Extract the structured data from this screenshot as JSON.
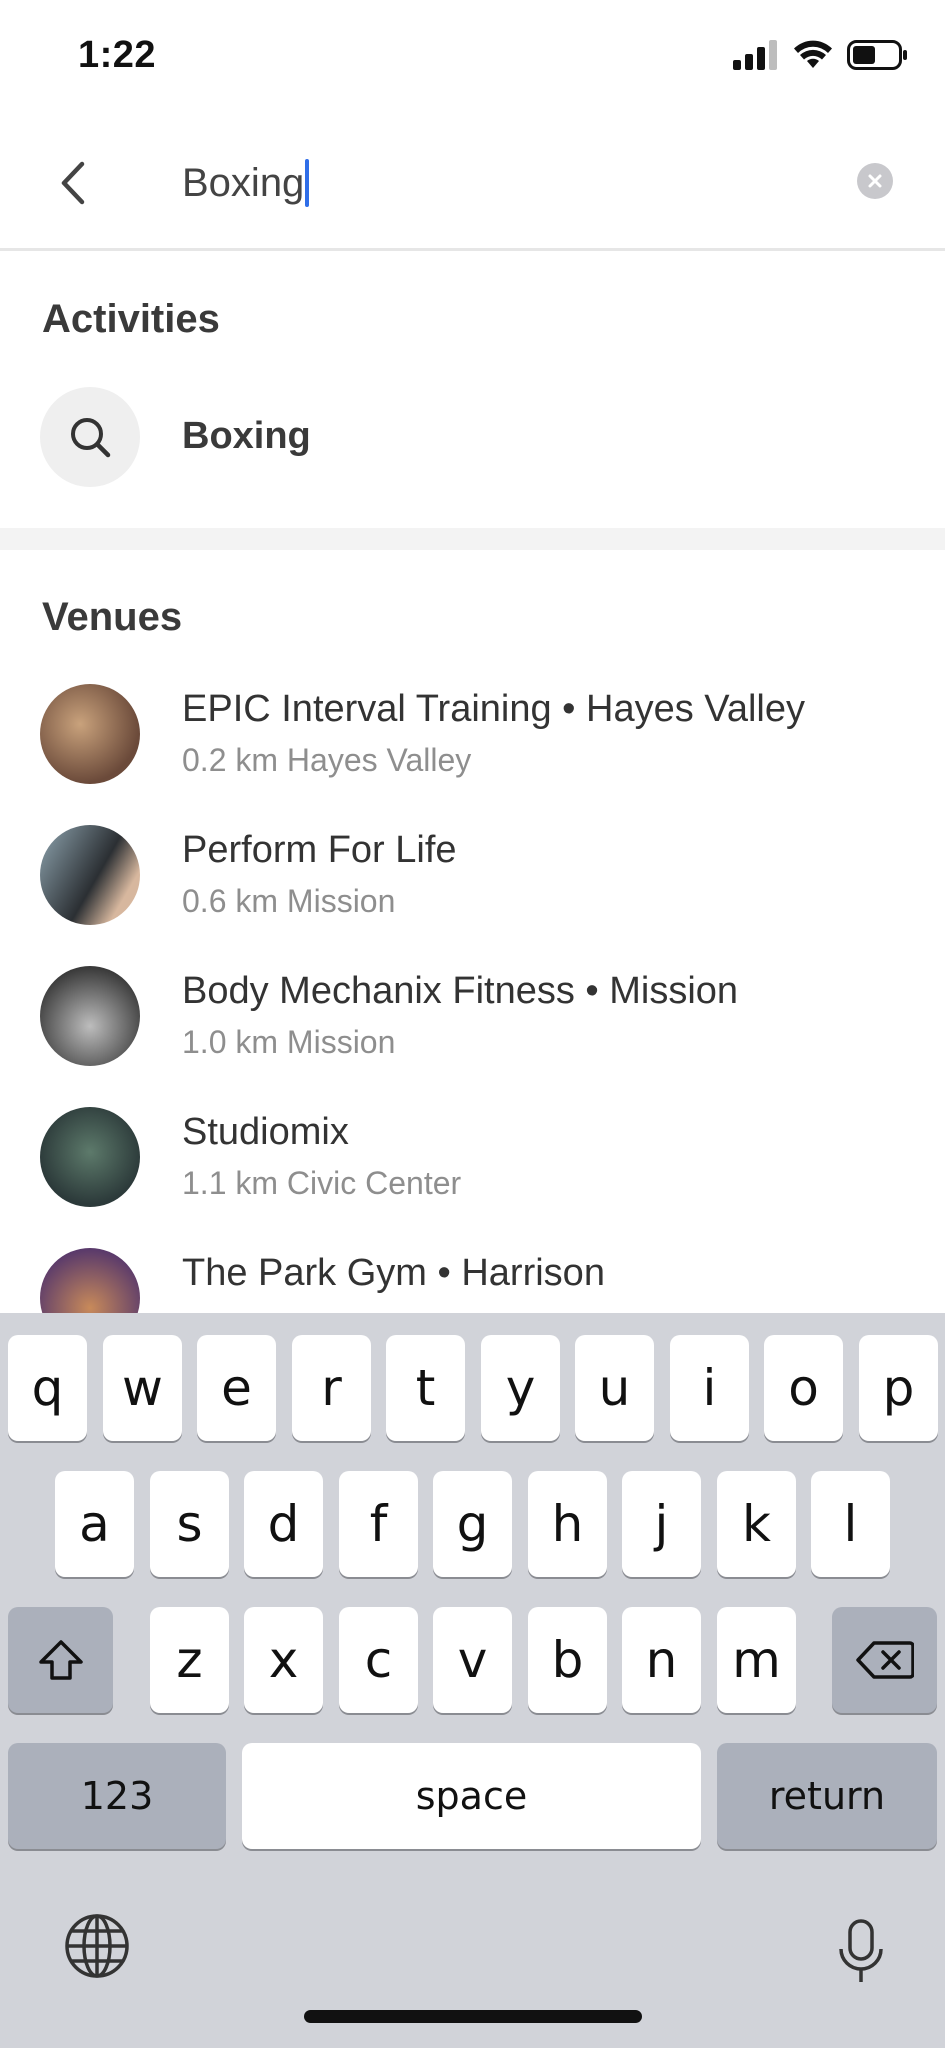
{
  "status_bar": {
    "time": "1:22"
  },
  "search": {
    "query": "Boxing"
  },
  "activities": {
    "title": "Activities",
    "items": [
      {
        "label": "Boxing",
        "icon": "search-icon"
      }
    ]
  },
  "venues": {
    "title": "Venues",
    "items": [
      {
        "name": "EPIC Interval Training • Hayes Valley",
        "sub": "0.2 km Hayes Valley",
        "avatar_colors": [
          "#6b4a3a",
          "#c9a27c"
        ]
      },
      {
        "name": "Perform For Life",
        "sub": "0.6 km Mission",
        "avatar_colors": [
          "#2b2f33",
          "#8fa5b0"
        ]
      },
      {
        "name": "Body Mechanix Fitness  • Mission",
        "sub": "1.0 km Mission",
        "avatar_colors": [
          "#3a3a3a",
          "#bdbdbd"
        ]
      },
      {
        "name": "Studiomix",
        "sub": "1.1 km Civic Center",
        "avatar_colors": [
          "#2c3a3a",
          "#5d7a6b"
        ]
      },
      {
        "name": "The Park Gym •  Harrison",
        "sub": "",
        "avatar_colors": [
          "#5a3a6b",
          "#c88a5a"
        ]
      }
    ]
  },
  "keyboard": {
    "row1": [
      "q",
      "w",
      "e",
      "r",
      "t",
      "y",
      "u",
      "i",
      "o",
      "p"
    ],
    "row2": [
      "a",
      "s",
      "d",
      "f",
      "g",
      "h",
      "j",
      "k",
      "l"
    ],
    "row3": [
      "z",
      "x",
      "c",
      "v",
      "b",
      "n",
      "m"
    ],
    "numbers_label": "123",
    "space_label": "space",
    "return_label": "return"
  }
}
